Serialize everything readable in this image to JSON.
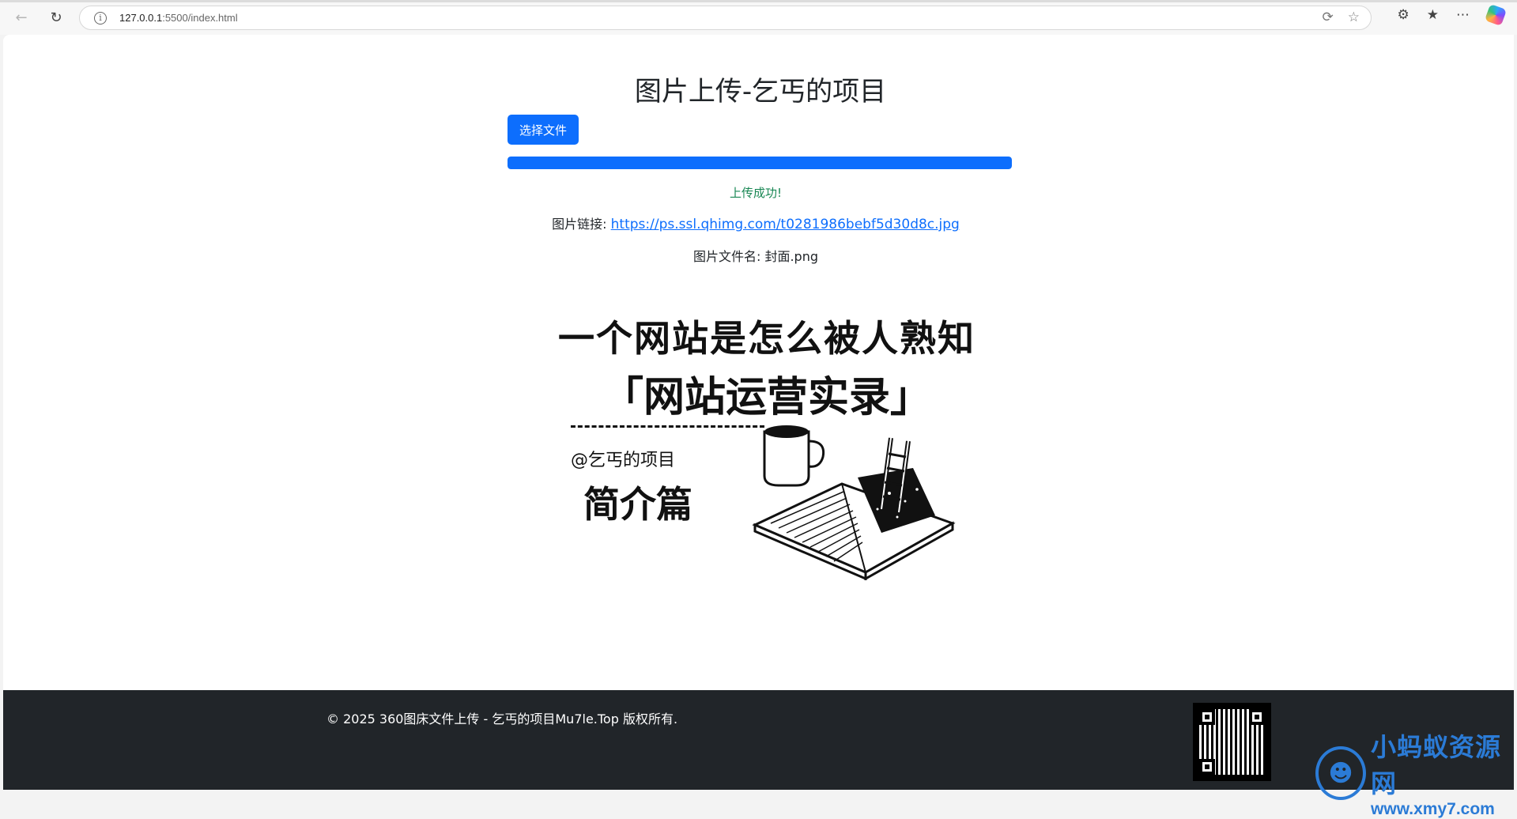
{
  "browser": {
    "url_host": "127.0.0.1",
    "url_rest": ":5500/index.html"
  },
  "page": {
    "title": "图片上传-乞丐的项目",
    "choose_button": "选择文件",
    "progress_percent": 100,
    "status": "上传成功!",
    "link_label": "图片链接:",
    "link_url": "https://ps.ssl.qhimg.com/t0281986bebf5d30d8c.jpg",
    "filename_label": "图片文件名:",
    "filename": "封面.png"
  },
  "preview": {
    "line1": "一个网站是怎么被人熟知",
    "line2": "「网站运营实录」",
    "author": "@乞丐的项目",
    "subtitle": "简介篇"
  },
  "footer": {
    "copyright": "© 2025 360图床文件上传 - 乞丐的项目Mu7le.Top 版权所有."
  },
  "watermark": {
    "name": "小蚂蚁资源网",
    "url": "www.xmy7.com"
  },
  "colors": {
    "primary": "#0d6efd",
    "success": "#198754",
    "footer_bg": "#212529"
  }
}
